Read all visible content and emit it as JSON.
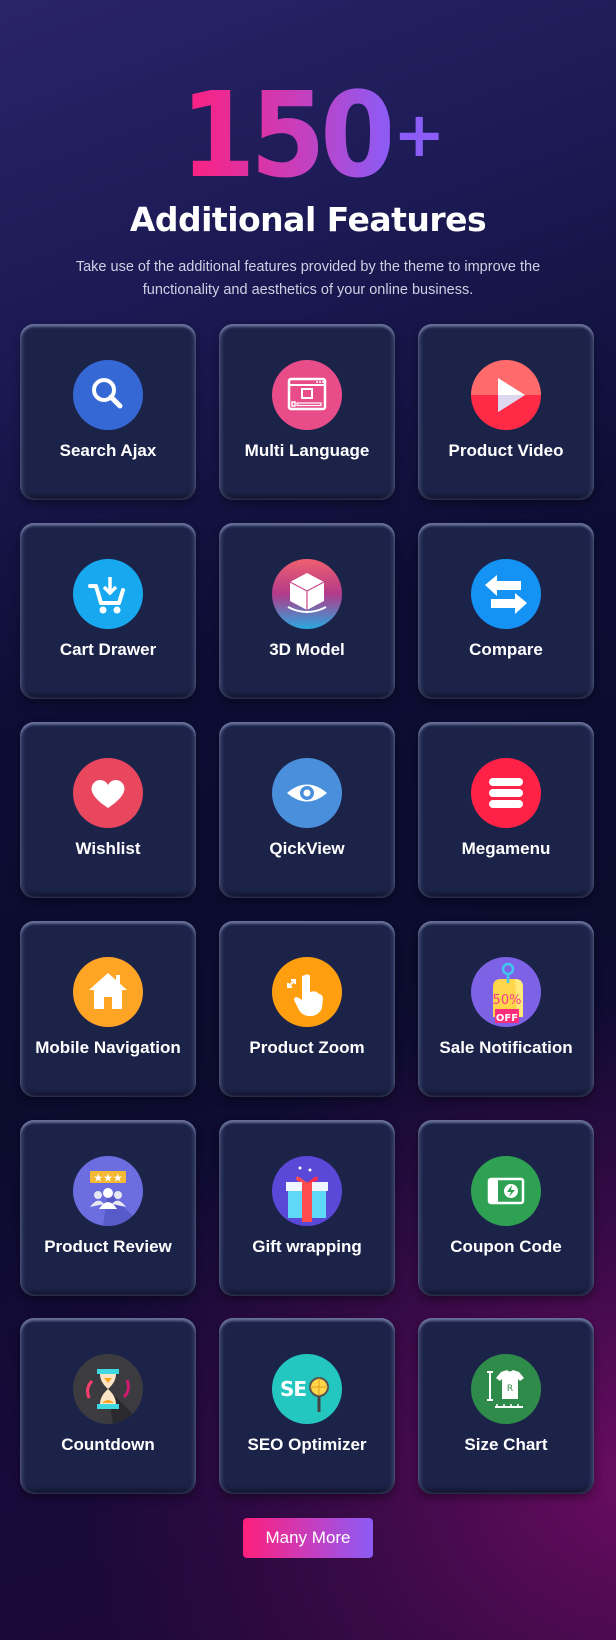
{
  "hero": {
    "count": "150",
    "suffix": "+",
    "title": "Additional Features",
    "subtitle": "Take use of the additional features provided by the theme to improve the functionality and aesthetics of your online business."
  },
  "features": [
    {
      "label": "Search Ajax",
      "icon": "search-icon",
      "color": "#3568d4"
    },
    {
      "label": "Multi Language",
      "icon": "language-browser-icon",
      "color": "#e84d8a"
    },
    {
      "label": "Product Video",
      "icon": "play-icon",
      "color": "#ff2a45"
    },
    {
      "label": "Cart Drawer",
      "icon": "cart-icon",
      "color": "#18a8f0"
    },
    {
      "label": "3D Model",
      "icon": "cube-icon",
      "color": "#c13d87"
    },
    {
      "label": "Compare",
      "icon": "compare-arrows-icon",
      "color": "#1493f5"
    },
    {
      "label": "Wishlist",
      "icon": "heart-icon",
      "color": "#e8475e"
    },
    {
      "label": "QickView",
      "icon": "eye-icon",
      "color": "#4a8fdc"
    },
    {
      "label": "Megamenu",
      "icon": "menu-icon",
      "color": "#ff2247"
    },
    {
      "label": "Mobile Navigation",
      "icon": "home-icon",
      "color": "#ffa526"
    },
    {
      "label": "Product Zoom",
      "icon": "touch-zoom-icon",
      "color": "#ff9f10"
    },
    {
      "label": "Sale Notification",
      "icon": "sale-tag-icon",
      "color": "#7e62e6"
    },
    {
      "label": "Product Review",
      "icon": "review-stars-icon",
      "color": "#6c6ee0"
    },
    {
      "label": "Gift wrapping",
      "icon": "gift-icon",
      "color": "#5a48d8"
    },
    {
      "label": "Coupon Code",
      "icon": "coupon-icon",
      "color": "#2fa152"
    },
    {
      "label": "Countdown",
      "icon": "hourglass-icon",
      "color": "#3b3b40"
    },
    {
      "label": "SEO Optimizer",
      "icon": "seo-icon",
      "color": "#23c7c0"
    },
    {
      "label": "Size Chart",
      "icon": "size-chart-icon",
      "color": "#2f8b49"
    }
  ],
  "cta": {
    "label": "Many More"
  }
}
